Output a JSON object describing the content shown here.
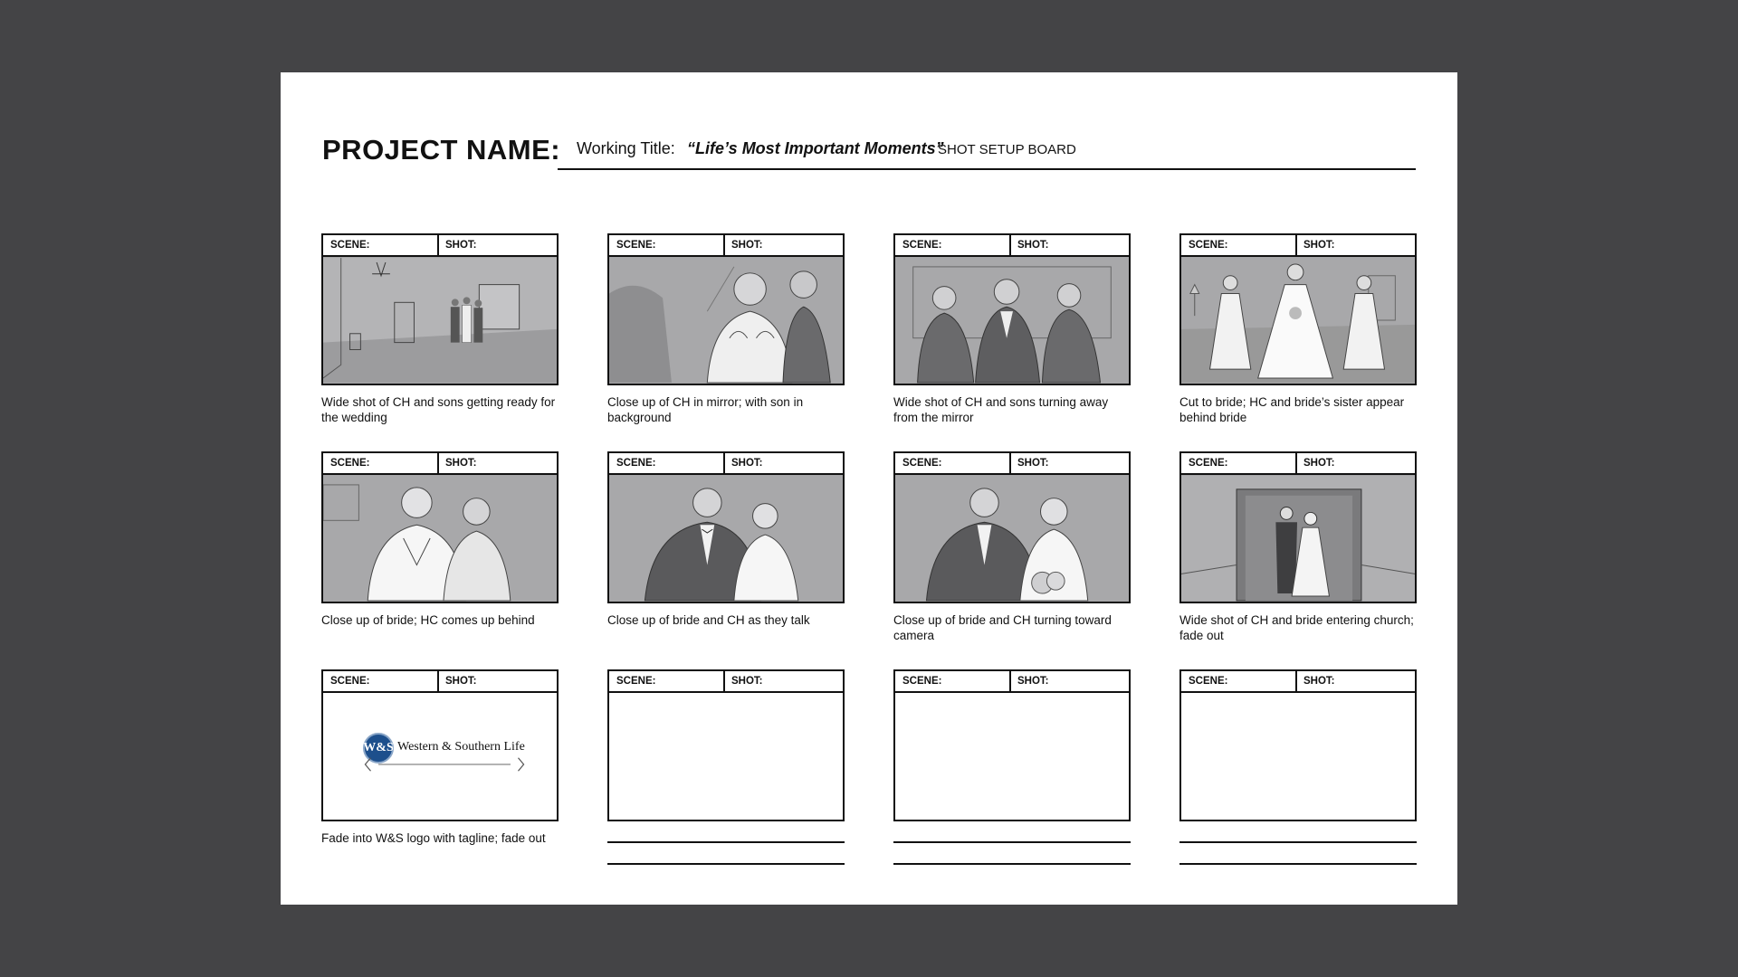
{
  "header": {
    "project_label": "PROJECT NAME:",
    "working_label": "Working Title:",
    "working_title": "“Life’s Most Important Moments”",
    "board_label": "SHOT SETUP BOARD"
  },
  "labels": {
    "scene": "SCENE:",
    "shot": "SHOT:"
  },
  "panels": [
    {
      "caption": "Wide shot of CH and sons getting ready for the wedding"
    },
    {
      "caption": "Close up of CH in mirror; with son in background"
    },
    {
      "caption": "Wide shot of CH and sons turning away from the mirror"
    },
    {
      "caption": "Cut to bride; HC and bride’s sister appear behind bride"
    },
    {
      "caption": "Close up of bride; HC comes up behind"
    },
    {
      "caption": "Close up of bride and CH as they talk"
    },
    {
      "caption": "Close up of bride and CH turning toward camera"
    },
    {
      "caption": "Wide shot of CH and bride entering church; fade out"
    },
    {
      "caption": "Fade into W&S logo with tagline; fade out"
    },
    {
      "caption": ""
    },
    {
      "caption": ""
    },
    {
      "caption": ""
    }
  ],
  "logo": {
    "badge": "W&S",
    "name": "Western & Southern Life"
  },
  "colors": {
    "background": "#444446",
    "sheet": "#ffffff",
    "sketch_gray": "#a5a5a7",
    "logo_blue": "#1d4f8c"
  }
}
